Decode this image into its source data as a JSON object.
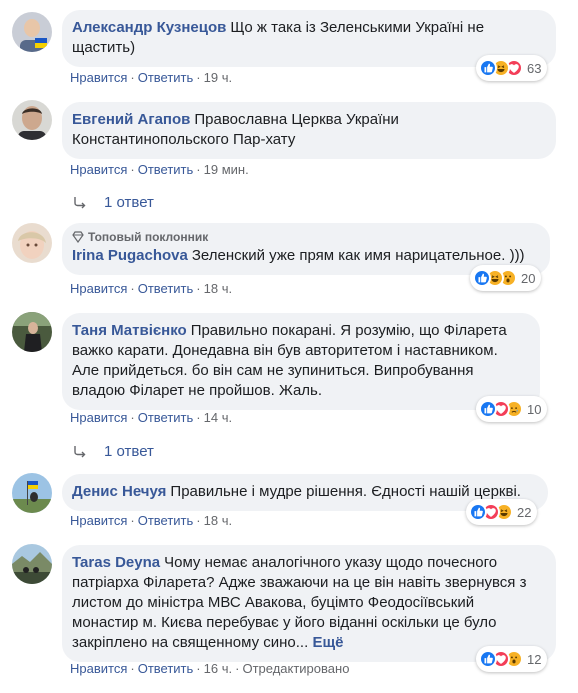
{
  "actions": {
    "like": "Нравится",
    "reply": "Ответить",
    "sep": "·",
    "edited": "Отредактировано"
  },
  "comments": [
    {
      "author": "Александр Кузнецов",
      "text": "Що ж така із Зеленськими Україні не щастить)",
      "time": "19 ч.",
      "reactions": [
        "like",
        "haha",
        "love"
      ],
      "count": "63"
    },
    {
      "author": "Евгений Агапов",
      "text": "Православна Церква України Константинопольского Пар-хату",
      "time": "19 мин.",
      "replies": "1 ответ"
    },
    {
      "badge": "Топовый поклонник",
      "author": "Irina Pugachova",
      "text": "Зеленский уже прям как имя нарицательное. )))",
      "time": "18 ч.",
      "reactions": [
        "like",
        "haha",
        "wow"
      ],
      "count": "20"
    },
    {
      "author": "Таня Матвієнко",
      "text": "Правильно покарані. Я розумію, що Філарета важко карати. Донедавна він був авторитетом і наставником. Але прийдеться. бо він сам не зупиниться. Випробування владою Філарет не пройшов. Жаль.",
      "time": "14 ч.",
      "reactions": [
        "like",
        "love",
        "sad"
      ],
      "count": "10",
      "replies": "1 ответ"
    },
    {
      "author": "Денис Нечуя",
      "text": "Правильне і мудре рішення. Єдності нашій церкві.",
      "time": "18 ч.",
      "reactions": [
        "like",
        "love",
        "haha"
      ],
      "count": "22"
    },
    {
      "author": "Taras Deyna",
      "text": "Чому немає аналогічного указу щодо почесного патріарха Філарета? Адже зважаючи на це він навіть звернувся з листом до міністра МВС Авакова, буцімто Феодосіївський монастир м. Києва перебуває у його віданні оскільки це було закріплено на священному сино...",
      "more": "Ещё",
      "time": "16 ч.",
      "edited": true,
      "reactions": [
        "like",
        "love",
        "wow"
      ],
      "count": "12"
    }
  ],
  "colors": {
    "link": "#385898",
    "bubble": "#f0f2f5",
    "meta": "#65676b",
    "like": "#1877f2",
    "love": "#f33e58",
    "emoji": "#f7b125"
  }
}
